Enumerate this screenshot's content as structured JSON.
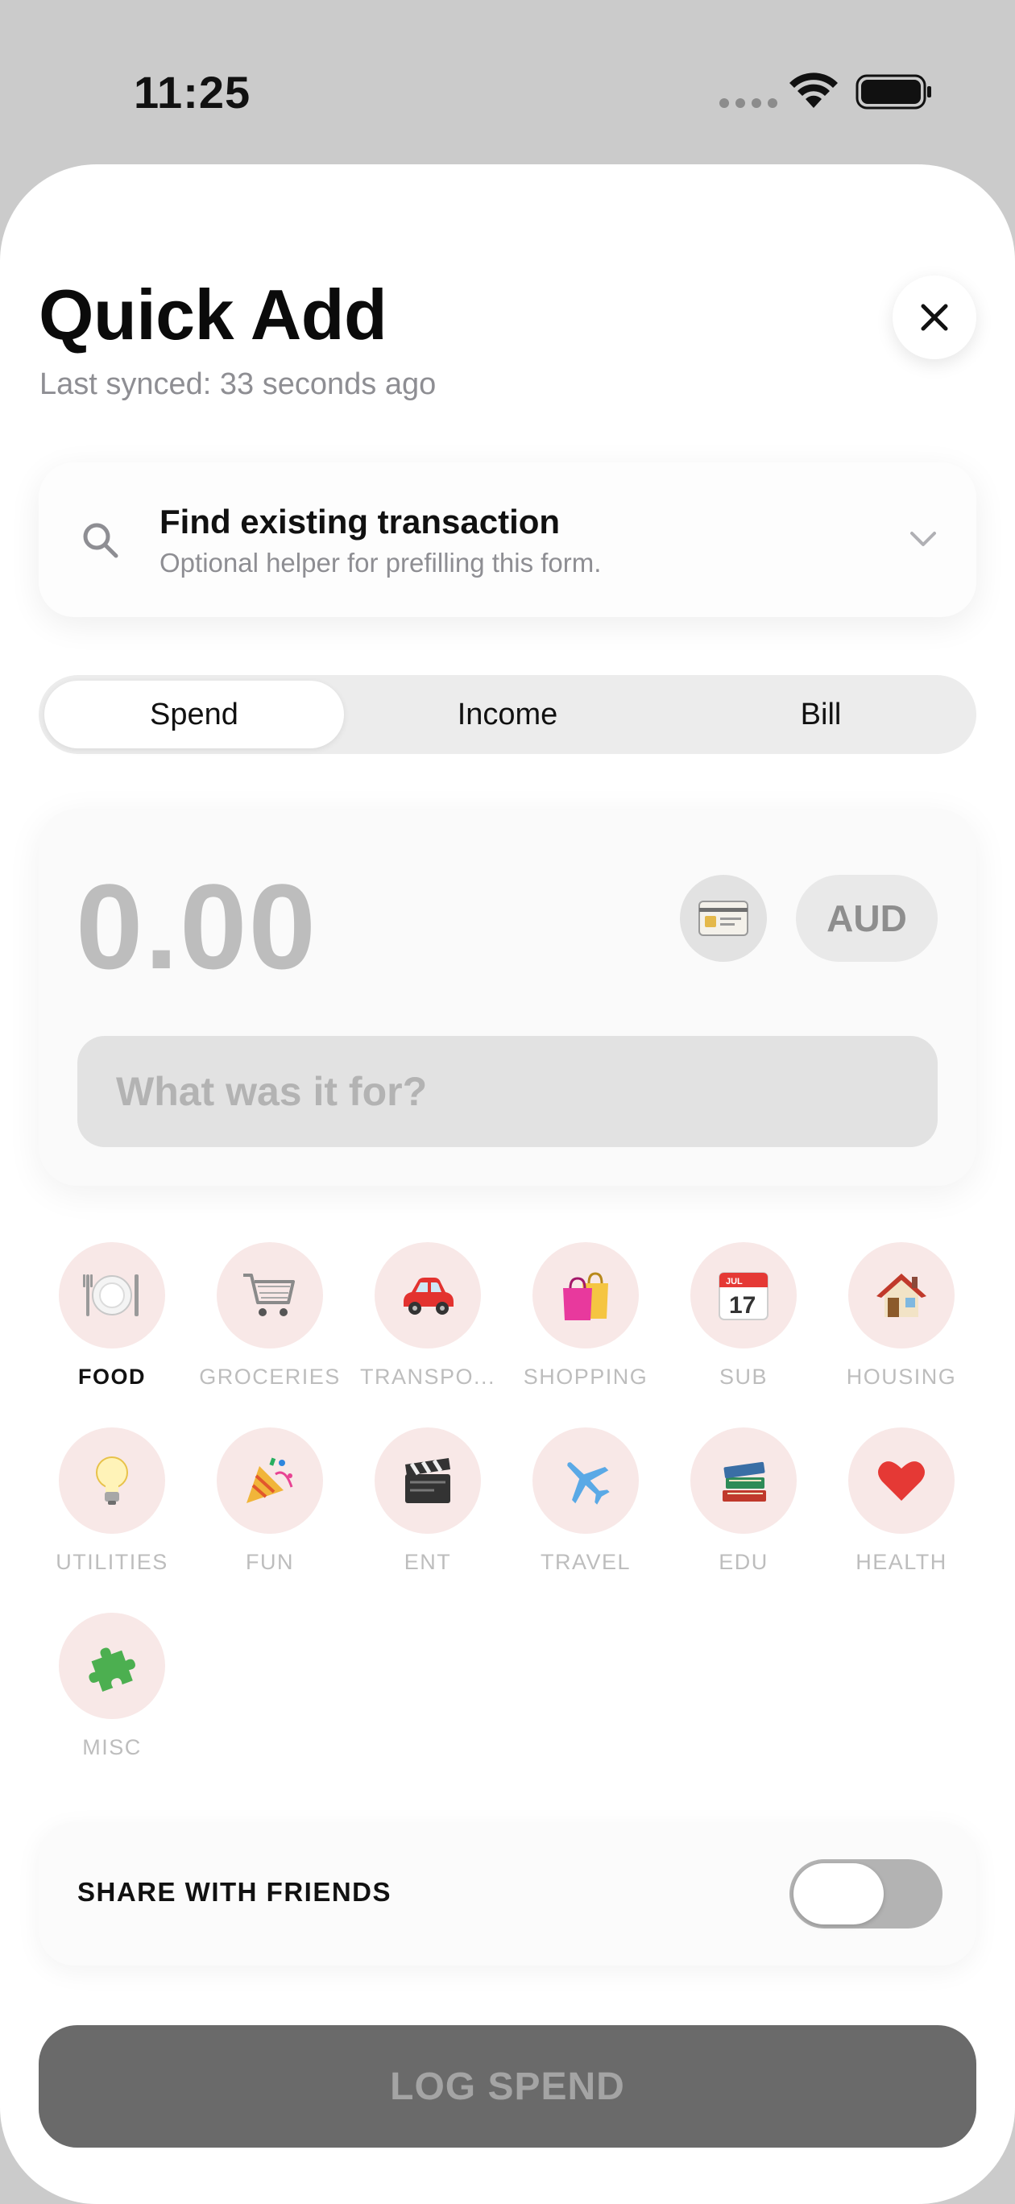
{
  "status": {
    "time": "11:25"
  },
  "header": {
    "title": "Quick Add",
    "subtitle": "Last synced: 33 seconds ago",
    "close_icon": "close-icon"
  },
  "search": {
    "title": "Find existing transaction",
    "subtitle": "Optional helper for prefilling this form."
  },
  "tabs": [
    {
      "label": "Spend",
      "active": true
    },
    {
      "label": "Income",
      "active": false
    },
    {
      "label": "Bill",
      "active": false
    }
  ],
  "amount": {
    "value": "0.00",
    "currency": "AUD",
    "description_placeholder": "What was it for?",
    "description_value": ""
  },
  "categories": [
    {
      "label": "FOOD",
      "emoji": "🍽️",
      "selected": true
    },
    {
      "label": "GROCERIES",
      "emoji": "🛒",
      "selected": false
    },
    {
      "label": "TRANSPO...",
      "emoji": "🚗",
      "selected": false
    },
    {
      "label": "SHOPPING",
      "emoji": "🛍️",
      "selected": false
    },
    {
      "label": "SUB",
      "emoji": "📅",
      "selected": false
    },
    {
      "label": "HOUSING",
      "emoji": "🏠",
      "selected": false
    },
    {
      "label": "UTILITIES",
      "emoji": "💡",
      "selected": false
    },
    {
      "label": "FUN",
      "emoji": "🎉",
      "selected": false
    },
    {
      "label": "ENT",
      "emoji": "🎬",
      "selected": false
    },
    {
      "label": "TRAVEL",
      "emoji": "✈️",
      "selected": false
    },
    {
      "label": "EDU",
      "emoji": "📚",
      "selected": false
    },
    {
      "label": "HEALTH",
      "emoji": "❤️",
      "selected": false
    },
    {
      "label": "MISC",
      "emoji": "🧩",
      "selected": false
    }
  ],
  "share": {
    "label": "SHARE WITH FRIENDS",
    "enabled": false
  },
  "submit": {
    "label": "LOG SPEND"
  },
  "colors": {
    "background": "#cbcbcb",
    "sheet": "#ffffff",
    "category_circle": "#f8e8e7",
    "submit_disabled": "#6a6a6a",
    "amount_placeholder": "#bdbdbd"
  }
}
